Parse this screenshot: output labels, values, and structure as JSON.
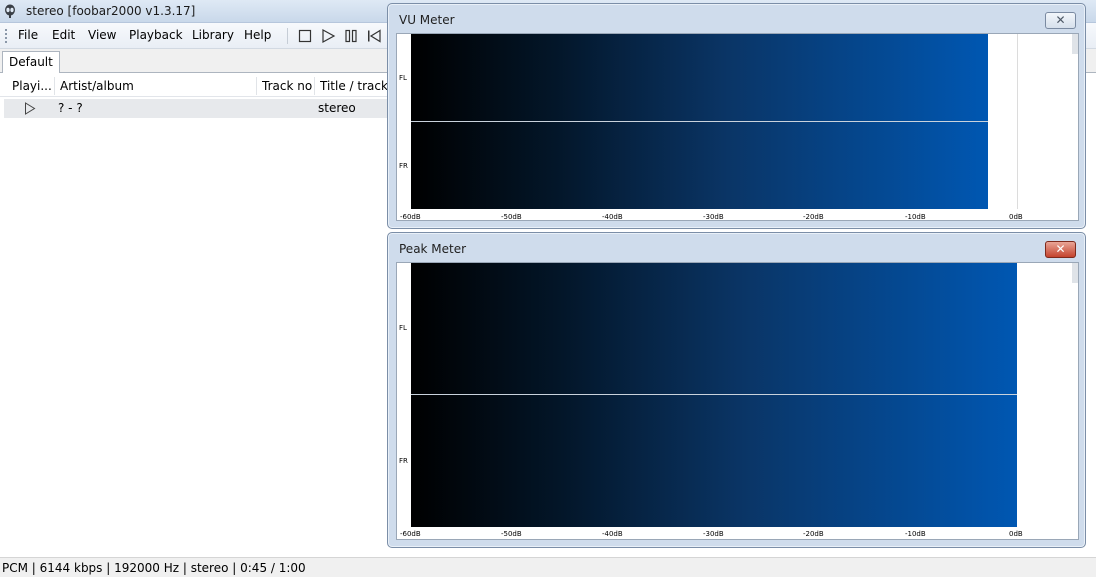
{
  "window": {
    "title": "stereo  [foobar2000 v1.3.17]"
  },
  "menu": {
    "items": [
      {
        "label": "File"
      },
      {
        "label": "Edit"
      },
      {
        "label": "View"
      },
      {
        "label": "Playback"
      },
      {
        "label": "Library"
      },
      {
        "label": "Help"
      }
    ]
  },
  "toolbar": {
    "buttons": [
      {
        "icon": "stop-icon"
      },
      {
        "icon": "play-icon"
      },
      {
        "icon": "pause-icon"
      },
      {
        "icon": "previous-icon"
      }
    ]
  },
  "tabs": [
    {
      "label": "Default"
    }
  ],
  "playlist": {
    "columns": [
      {
        "label": "Playi..."
      },
      {
        "label": "Artist/album"
      },
      {
        "label": "Track no"
      },
      {
        "label": "Title / track a"
      }
    ],
    "rows": [
      {
        "playing_icon": "play-outline-icon",
        "artist_album": "? - ?",
        "track_no": "",
        "title": "stereo"
      }
    ]
  },
  "status": {
    "text": "PCM | 6144 kbps | 192000 Hz | stereo | 0:45 / 1:00"
  },
  "vu_meter": {
    "title": "VU Meter",
    "close_icon": "close-icon",
    "channels": [
      "FL",
      "FR"
    ],
    "scale": [
      "-60dB",
      "-50dB",
      "-40dB",
      "-30dB",
      "-20dB",
      "-10dB",
      "0dB"
    ],
    "level_fraction": 0.952
  },
  "peak_meter": {
    "title": "Peak Meter",
    "close_icon": "close-icon",
    "channels": [
      "FL",
      "FR"
    ],
    "scale": [
      "-60dB",
      "-50dB",
      "-40dB",
      "-30dB",
      "-20dB",
      "-10dB",
      "0dB"
    ],
    "level_fraction": 1.0
  },
  "colors": {
    "meter_dark": "#000000",
    "meter_bright": "#0057b2",
    "close_hover": "#c4432d"
  }
}
